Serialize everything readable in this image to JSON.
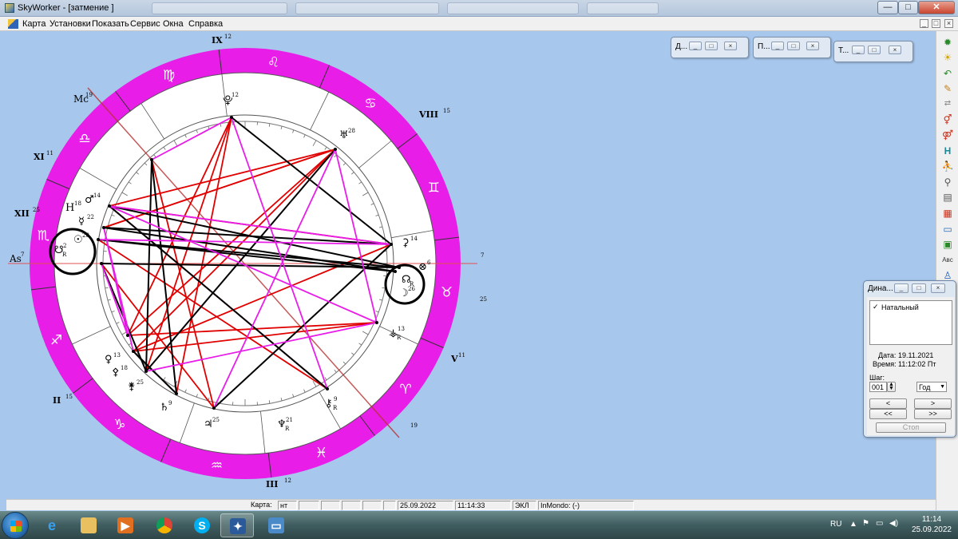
{
  "window": {
    "title": "SkyWorker - [затмение ]",
    "controls": [
      "—",
      "□",
      "✕"
    ]
  },
  "menu": {
    "items": [
      "Карта",
      "Установки",
      "Показать",
      "Сервис",
      "Окна",
      "Справка"
    ],
    "mdi_controls": [
      "_",
      "□",
      "×"
    ]
  },
  "chart": {
    "colors": {
      "zodiac_ring": "#e81ee8",
      "aspect_red": "#e00000",
      "aspect_black": "#000000",
      "aspect_magenta": "#e81ee8",
      "axis_line": "#e05050"
    },
    "signs": [
      "♍",
      "♌",
      "♋",
      "♊",
      "♉",
      "♈",
      "♓",
      "♒",
      "♑",
      "♐",
      "♏",
      "♎"
    ],
    "angles": {
      "asc": "As",
      "asc_deg": "7",
      "mc": "Mc",
      "mc_deg": "19",
      "asc_right_deg": "7",
      "right_deg_25": "25",
      "bottom_deg_19": "19"
    },
    "houses": [
      {
        "label": "IX",
        "deg": "12"
      },
      {
        "label": "VIII",
        "deg": "15"
      },
      {
        "label": "XI",
        "deg": "11"
      },
      {
        "label": "XII",
        "deg": "25"
      },
      {
        "label": "V",
        "deg": "11"
      },
      {
        "label": "II",
        "deg": "15"
      },
      {
        "label": "III",
        "deg": "12"
      }
    ],
    "planets": [
      {
        "glyph": "⯓",
        "deg": "12"
      },
      {
        "glyph": "♅",
        "deg": "28"
      },
      {
        "glyph": "♂",
        "deg": "14"
      },
      {
        "glyph": "H",
        "deg": "18"
      },
      {
        "glyph": "☿",
        "deg": "22"
      },
      {
        "glyph": "☉",
        "deg": "28"
      },
      {
        "glyph": "☋",
        "deg": "2",
        "retro": "R"
      },
      {
        "glyph": "⚳",
        "deg": "14"
      },
      {
        "glyph": "☊",
        "deg": "",
        "retro": "R"
      },
      {
        "glyph": "☽",
        "deg": "26"
      },
      {
        "glyph": "⚶",
        "deg": "13",
        "retro": "R"
      },
      {
        "glyph": "♀",
        "deg": "13"
      },
      {
        "glyph": "⚴",
        "deg": "18"
      },
      {
        "glyph": "⚵",
        "deg": "25"
      },
      {
        "glyph": "♄",
        "deg": "9"
      },
      {
        "glyph": "♃",
        "deg": "25"
      },
      {
        "glyph": "♆",
        "deg": "21",
        "retro": "R"
      },
      {
        "glyph": "⚷",
        "deg": "9",
        "retro": "R"
      },
      {
        "glyph": "⊗",
        "deg": "6"
      }
    ]
  },
  "mini_windows": [
    {
      "title": "Д..."
    },
    {
      "title": "П..."
    },
    {
      "title": "Т..."
    }
  ],
  "right_toolbar": [
    "star-sun-icon",
    "sun-icon",
    "return-arrow-icon",
    "pencil-icon",
    "arrows-icon",
    "gender-icon",
    "venus-mars-icon",
    "h-letter-icon",
    "runner-icon",
    "magnifier-icon",
    "document-icon",
    "calendar-icon",
    "scanner-icon",
    "gallery-icon",
    "abc-icon",
    "person-icon"
  ],
  "dynamics": {
    "title": "Дина...",
    "list_item": "Натальный",
    "date_label": "Дата:",
    "date": "19.11.2021",
    "time_label": "Время:",
    "time": "11:12:02 Пт",
    "step_label": "Шаг:",
    "step_value": "001",
    "unit": "Год",
    "btn_prev": "<",
    "btn_next": ">",
    "btn_prev_fast": "<<",
    "btn_next_fast": ">>",
    "btn_stop": "Стоп"
  },
  "statusbar": {
    "chart_label": "Карта:",
    "chart_value": "нт",
    "date": "25.09.2022",
    "time": "11:14:33",
    "mode": "ЭКЛ",
    "inmondo": "InMondo: (-)"
  },
  "taskbar": {
    "lang": "RU",
    "time": "11:14",
    "date": "25.09.2022"
  }
}
